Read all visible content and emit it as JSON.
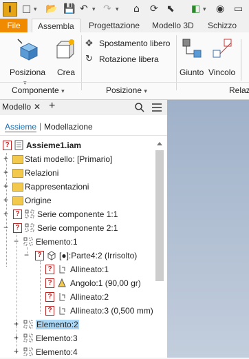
{
  "quick_access": {
    "logo": "I"
  },
  "ribbon_tabs": [
    "File",
    "Assembla",
    "Progettazione",
    "Modello 3D",
    "Schizzo"
  ],
  "ribbon": {
    "posiziona": "Posiziona",
    "crea": "Crea",
    "spostamento": "Spostamento libero",
    "rotazione": "Rotazione libera",
    "giunto": "Giunto",
    "vincolo": "Vincolo",
    "group_componente": "Componente",
    "group_posizione": "Posizione",
    "group_relazioni": "Relazi"
  },
  "panel": {
    "title": "Modello",
    "close": "✕",
    "add": "+",
    "tab_assieme": "Assieme",
    "tab_separator": "|",
    "tab_modellazione": "Modellazione"
  },
  "tree": {
    "root": "Assieme1.iam",
    "stati": "Stati modello: [Primario]",
    "relazioni": "Relazioni",
    "rappresentazioni": "Rappresentazioni",
    "origine": "Origine",
    "serie1": "Serie componente 1:1",
    "serie2": "Serie componente 2:1",
    "elemento1": "Elemento:1",
    "parte": "[●]:Parte4:2 (Irrisolto)",
    "allineato1": "Allineato:1",
    "angolo": "Angolo:1 (90,00 gr)",
    "allineato2": "Allineato:2",
    "allineato3": "Allineato:3 (0,500 mm)",
    "elemento2": "Elemento:2",
    "elemento3": "Elemento:3",
    "elemento4": "Elemento:4"
  },
  "colors": {
    "file_tab": "#f08a00",
    "selection": "#a9d7f5",
    "error": "#cc2222",
    "viewport": "#b3c1d4"
  }
}
